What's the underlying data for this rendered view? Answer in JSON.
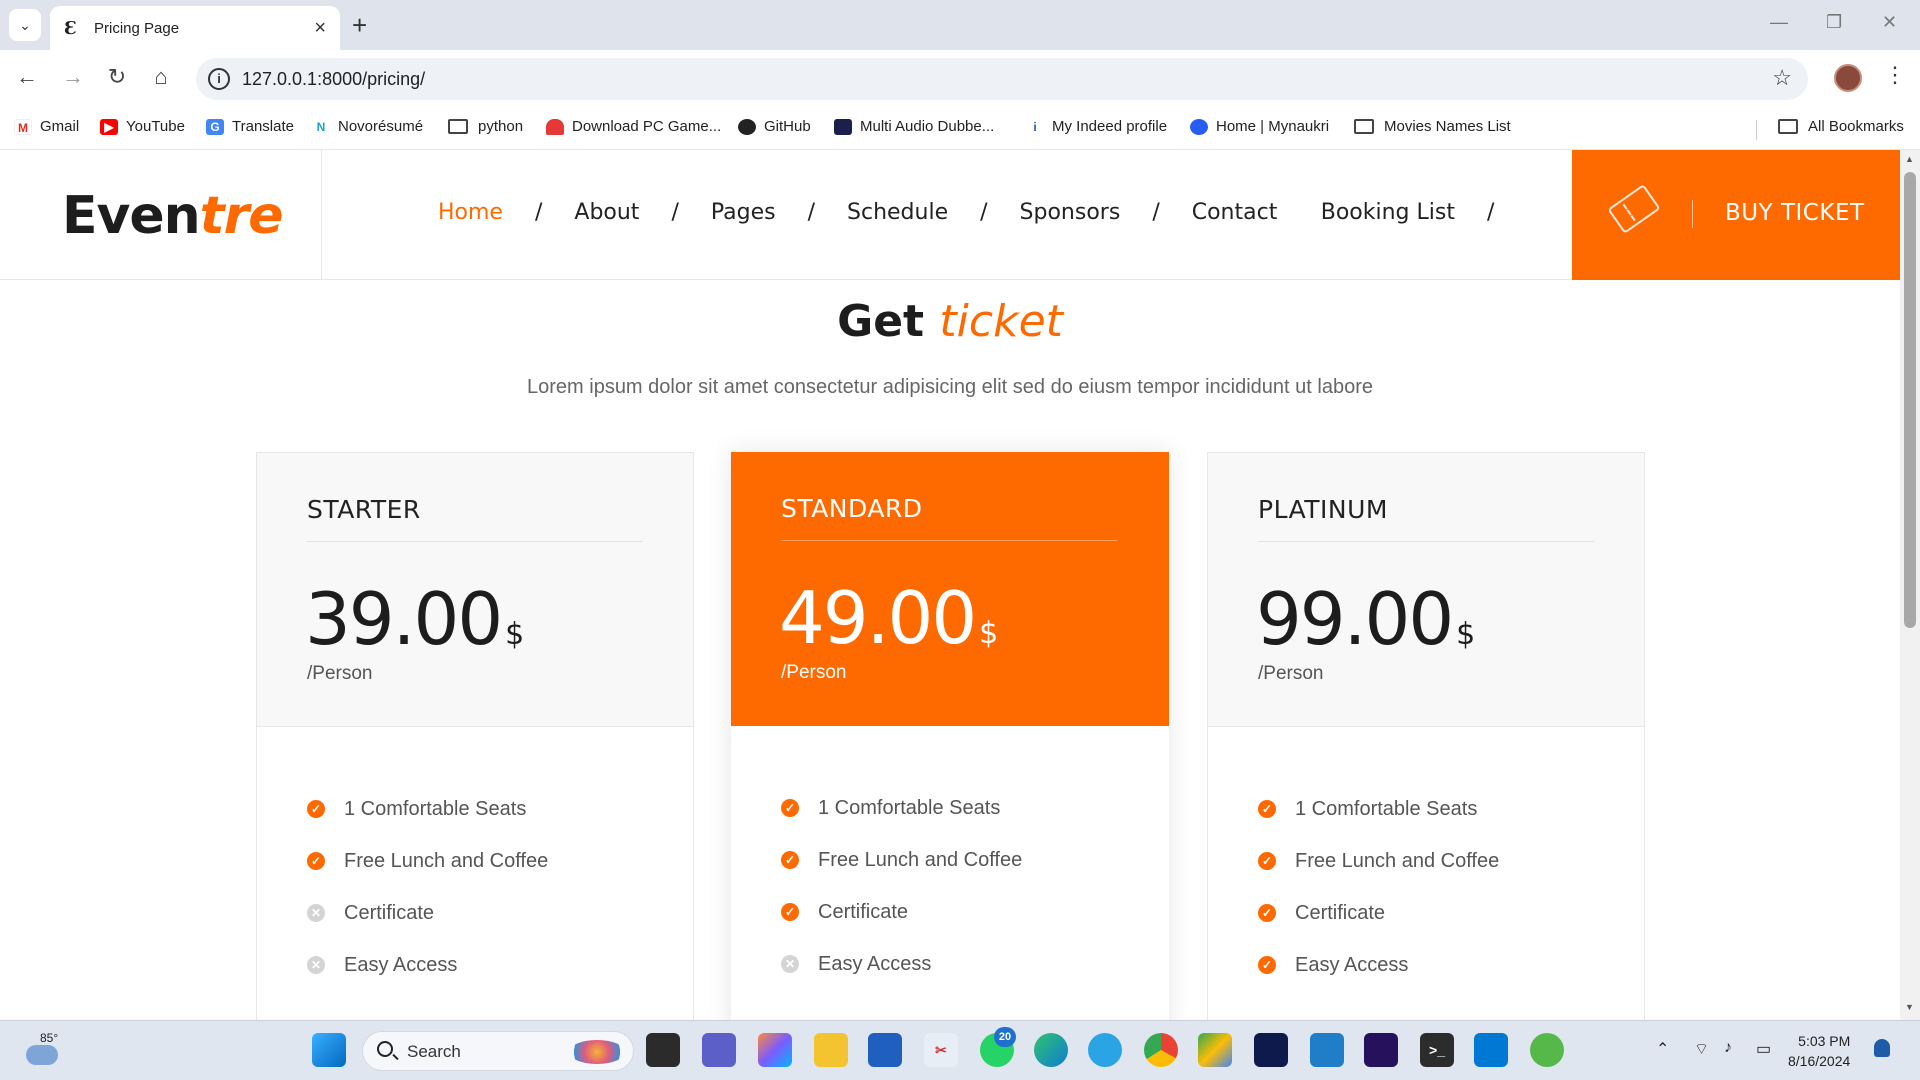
{
  "browser": {
    "tab_title": "Pricing Page",
    "tab_favicon": "Ɛ",
    "url": "127.0.0.1:8000/pricing/",
    "bookmarks": [
      {
        "label": "Gmail",
        "icon": "gmail-icon"
      },
      {
        "label": "YouTube",
        "icon": "youtube-icon"
      },
      {
        "label": "Translate",
        "icon": "translate-icon"
      },
      {
        "label": "Novorésumé",
        "icon": "novoresume-icon"
      },
      {
        "label": "python",
        "icon": "folder-icon"
      },
      {
        "label": "Download PC Game...",
        "icon": "game-icon"
      },
      {
        "label": "GitHub",
        "icon": "github-icon"
      },
      {
        "label": "Multi Audio Dubbe...",
        "icon": "movie-icon"
      },
      {
        "label": "My Indeed profile",
        "icon": "indeed-icon"
      },
      {
        "label": "Home | Mynaukri",
        "icon": "naukri-icon"
      },
      {
        "label": "Movies Names List",
        "icon": "folder-icon"
      }
    ],
    "all_bookmarks": "All Bookmarks"
  },
  "site": {
    "logo_main": "Even",
    "logo_accent": "tre",
    "nav": [
      "Home",
      "About",
      "Pages",
      "Schedule",
      "Sponsors",
      "Contact",
      "Booking List"
    ],
    "active_nav": "Home",
    "buy_ticket": "BUY TICKET"
  },
  "section": {
    "title_main": "Get",
    "title_accent": "ticket",
    "subtitle": "Lorem ipsum dolor sit amet consectetur adipisicing elit sed do eiusm tempor incididunt ut labore"
  },
  "plans": [
    {
      "name": "STARTER",
      "price": "39.00",
      "currency": "$",
      "per": "/Person",
      "featured": false,
      "features": [
        {
          "label": "1 Comfortable Seats",
          "included": true
        },
        {
          "label": "Free Lunch and Coffee",
          "included": true
        },
        {
          "label": "Certificate",
          "included": false
        },
        {
          "label": "Easy Access",
          "included": false
        }
      ]
    },
    {
      "name": "STANDARD",
      "price": "49.00",
      "currency": "$",
      "per": "/Person",
      "featured": true,
      "features": [
        {
          "label": "1 Comfortable Seats",
          "included": true
        },
        {
          "label": "Free Lunch and Coffee",
          "included": true
        },
        {
          "label": "Certificate",
          "included": true
        },
        {
          "label": "Easy Access",
          "included": false
        }
      ]
    },
    {
      "name": "PLATINUM",
      "price": "99.00",
      "currency": "$",
      "per": "/Person",
      "featured": false,
      "features": [
        {
          "label": "1 Comfortable Seats",
          "included": true
        },
        {
          "label": "Free Lunch and Coffee",
          "included": true
        },
        {
          "label": "Certificate",
          "included": true
        },
        {
          "label": "Easy Access",
          "included": true
        }
      ]
    }
  ],
  "taskbar": {
    "weather_temp": "85°",
    "search_label": "Search",
    "whatsapp_badge": "20",
    "time": "5:03 PM",
    "date": "8/16/2024"
  },
  "colors": {
    "accent": "#ff6a00",
    "included": "#ff6a00",
    "excluded": "#d4d4d4"
  }
}
